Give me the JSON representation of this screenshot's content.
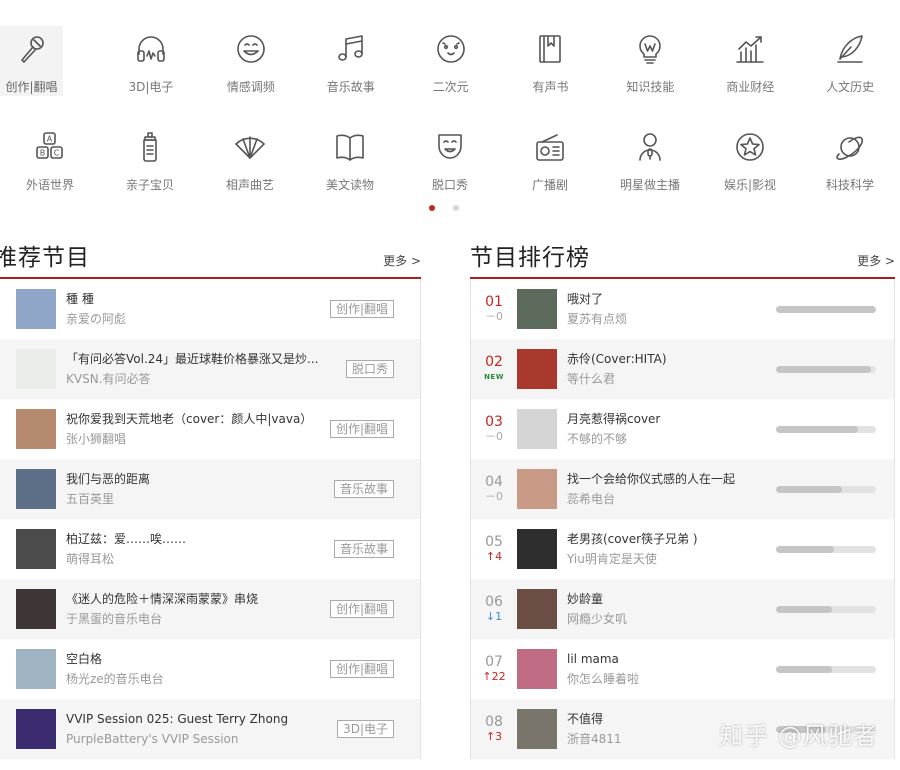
{
  "categories_row1": [
    {
      "label": "创作|翻唱",
      "icon": "microphone-icon"
    },
    {
      "label": "3D|电子",
      "icon": "headphones-icon"
    },
    {
      "label": "情感调频",
      "icon": "smiley-icon"
    },
    {
      "label": "音乐故事",
      "icon": "music-note-icon"
    },
    {
      "label": "二次元",
      "icon": "anime-face-icon"
    },
    {
      "label": "有声书",
      "icon": "book-icon"
    },
    {
      "label": "知识技能",
      "icon": "lightbulb-icon"
    },
    {
      "label": "商业财经",
      "icon": "growth-chart-icon"
    },
    {
      "label": "人文历史",
      "icon": "quill-icon"
    }
  ],
  "categories_row2": [
    {
      "label": "外语世界",
      "icon": "abc-blocks-icon"
    },
    {
      "label": "亲子宝贝",
      "icon": "baby-bottle-icon"
    },
    {
      "label": "相声曲艺",
      "icon": "fan-icon"
    },
    {
      "label": "美文读物",
      "icon": "open-book-icon"
    },
    {
      "label": "脱口秀",
      "icon": "mask-icon"
    },
    {
      "label": "广播剧",
      "icon": "radio-icon"
    },
    {
      "label": "明星做主播",
      "icon": "person-mic-icon"
    },
    {
      "label": "娱乐|影视",
      "icon": "star-icon"
    },
    {
      "label": "科技科学",
      "icon": "planet-icon"
    }
  ],
  "recommend": {
    "title": "推荐节目",
    "more": "更多 >",
    "items": [
      {
        "title": "種 種",
        "sub": "亲爱の阿彪",
        "tag": "创作|翻唱",
        "thumb": "#8fa6c9"
      },
      {
        "title": "「有问必答Vol.24」最近球鞋价格暴涨又是炒...",
        "sub": "KVSN.有问必答",
        "tag": "脱口秀",
        "thumb": "#e9eee9"
      },
      {
        "title": "祝你爱我到天荒地老（cover：颜人中|vava）",
        "sub": "张小狮翻唱",
        "tag": "创作|翻唱",
        "thumb": "#b58a6e"
      },
      {
        "title": "我们与恶的距离",
        "sub": "五百英里",
        "tag": "音乐故事",
        "thumb": "#5d6f86"
      },
      {
        "title": "柏辽兹：爱……唉……",
        "sub": "萌得耳松",
        "tag": "音乐故事",
        "thumb": "#4b4b4b"
      },
      {
        "title": "《迷人的危险＋情深深雨蒙蒙》串烧",
        "sub": "于黑蛋的音乐电台",
        "tag": "创作|翻唱",
        "thumb": "#3d3533"
      },
      {
        "title": "空白格",
        "sub": "杨光ze的音乐电台",
        "tag": "创作|翻唱",
        "thumb": "#9fb3c2"
      },
      {
        "title": "VVIP Session 025: Guest Terry Zhong",
        "sub": "PurpleBattery's VVIP Session",
        "tag": "3D|电子",
        "thumb": "#3b2a6e"
      }
    ]
  },
  "ranking": {
    "title": "节目排行榜",
    "more": "更多 >",
    "items": [
      {
        "rank": "01",
        "change": "－0",
        "dir": "same",
        "title": "哦对了",
        "sub": "夏苏有点烦",
        "heat": 1.0,
        "thumb": "#5b6a5a"
      },
      {
        "rank": "02",
        "change": "NEW",
        "dir": "new",
        "title": "赤伶(Cover:HITA)",
        "sub": "等什么君",
        "heat": 0.95,
        "thumb": "#a8392c"
      },
      {
        "rank": "03",
        "change": "－0",
        "dir": "same",
        "title": "月亮惹得祸cover",
        "sub": "不够的不够",
        "heat": 0.82,
        "thumb": "#d5d5d5"
      },
      {
        "rank": "04",
        "change": "－0",
        "dir": "same",
        "title": "找一个会给你仪式感的人在一起",
        "sub": "蕊希电台",
        "heat": 0.66,
        "thumb": "#c99a86"
      },
      {
        "rank": "05",
        "change": "4",
        "dir": "up",
        "title": "老男孩(cover筷子兄弟 )",
        "sub": "Yiu明肯定是天使",
        "heat": 0.58,
        "thumb": "#2e2e2e"
      },
      {
        "rank": "06",
        "change": "1",
        "dir": "down",
        "title": "妙龄童",
        "sub": "网瘾少女叽",
        "heat": 0.56,
        "thumb": "#6a4e44"
      },
      {
        "rank": "07",
        "change": "22",
        "dir": "up",
        "title": "lil mama",
        "sub": "你怎么睡着啦",
        "heat": 0.56,
        "thumb": "#c06c84"
      },
      {
        "rank": "08",
        "change": "3",
        "dir": "up",
        "title": "不值得",
        "sub": "浙音4811",
        "heat": 0.5,
        "thumb": "#7a756b"
      }
    ]
  },
  "watermark": "知乎 @风驰者",
  "colors": {
    "accent": "#c8251e",
    "divider": "#a3231c"
  }
}
